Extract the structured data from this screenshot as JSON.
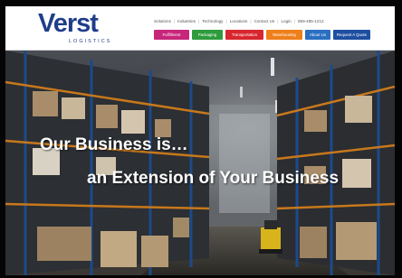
{
  "logo": {
    "name": "Verst",
    "subtitle": "LOGISTICS"
  },
  "top_nav": [
    "Solutions",
    "Industries",
    "Technology",
    "Locations",
    "Contact Us",
    "Login",
    "859-485-1212"
  ],
  "main_nav": [
    {
      "label": "Fulfillment",
      "color": "#c8267a"
    },
    {
      "label": "Packaging",
      "color": "#2e9b3c"
    },
    {
      "label": "Transportation",
      "color": "#d8262e"
    },
    {
      "label": "Warehousing",
      "color": "#ef7f1a"
    },
    {
      "label": "About Us",
      "color": "#2a6fc0"
    },
    {
      "label": "Request A Quote",
      "color": "#1e4fa0"
    }
  ],
  "hero": {
    "tagline_line1": "Our Business is…",
    "tagline_line2": "an Extension of Your Business"
  },
  "colors": {
    "brand_blue": "#1f3d8a",
    "header_bg": "#ffffff"
  }
}
